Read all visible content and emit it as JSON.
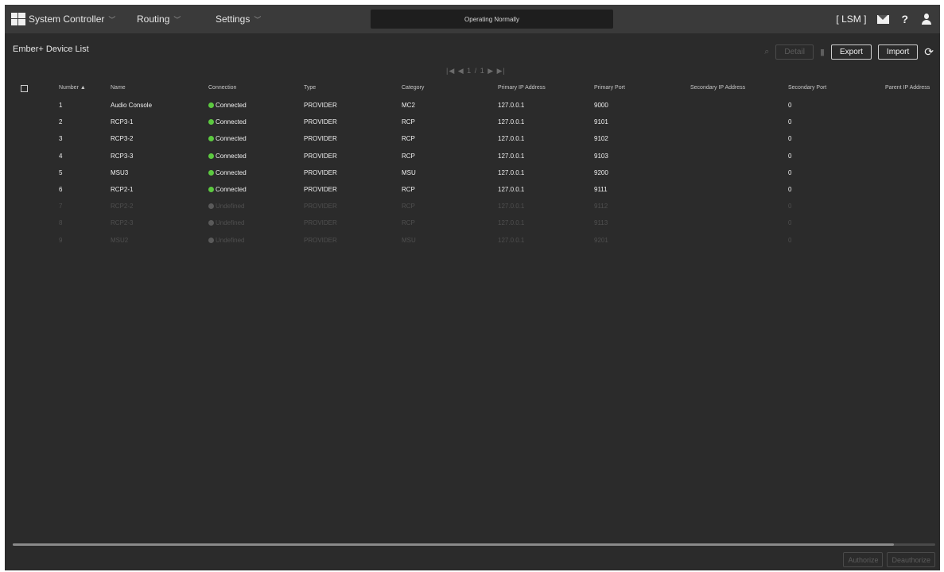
{
  "topbar": {
    "app_menu": "System Controller",
    "routing_menu": "Routing",
    "settings_menu": "Settings",
    "status": "Operating Normally",
    "mode": "[ LSM ]",
    "help": "?"
  },
  "page": {
    "title": "Ember+ Device List",
    "pager": "|◀ ◀ 1 / 1 ▶ ▶|"
  },
  "toolbar": {
    "detail_label": "Detail",
    "export_label": "Export",
    "import_label": "Import"
  },
  "table": {
    "headers": {
      "number": "Number ▲",
      "name": "Name",
      "connection": "Connection",
      "type": "Type",
      "category": "Category",
      "primary_ip": "Primary IP Address",
      "primary_port": "Primary Port",
      "secondary_ip": "Secondary IP Address",
      "secondary_port": "Secondary Port",
      "parent_ip": "Parent IP Address"
    },
    "rows": [
      {
        "number": "1",
        "name": "Audio Console",
        "connection": "Connected",
        "type": "PROVIDER",
        "category": "MC2",
        "primary_ip": "127.0.0.1",
        "primary_port": "9000",
        "secondary_ip": "",
        "secondary_port": "0",
        "parent_ip": ""
      },
      {
        "number": "2",
        "name": "RCP3-1",
        "connection": "Connected",
        "type": "PROVIDER",
        "category": "RCP",
        "primary_ip": "127.0.0.1",
        "primary_port": "9101",
        "secondary_ip": "",
        "secondary_port": "0",
        "parent_ip": ""
      },
      {
        "number": "3",
        "name": "RCP3-2",
        "connection": "Connected",
        "type": "PROVIDER",
        "category": "RCP",
        "primary_ip": "127.0.0.1",
        "primary_port": "9102",
        "secondary_ip": "",
        "secondary_port": "0",
        "parent_ip": ""
      },
      {
        "number": "4",
        "name": "RCP3-3",
        "connection": "Connected",
        "type": "PROVIDER",
        "category": "RCP",
        "primary_ip": "127.0.0.1",
        "primary_port": "9103",
        "secondary_ip": "",
        "secondary_port": "0",
        "parent_ip": ""
      },
      {
        "number": "5",
        "name": "MSU3",
        "connection": "Connected",
        "type": "PROVIDER",
        "category": "MSU",
        "primary_ip": "127.0.0.1",
        "primary_port": "9200",
        "secondary_ip": "",
        "secondary_port": "0",
        "parent_ip": ""
      },
      {
        "number": "6",
        "name": "RCP2-1",
        "connection": "Connected",
        "type": "PROVIDER",
        "category": "RCP",
        "primary_ip": "127.0.0.1",
        "primary_port": "9111",
        "secondary_ip": "",
        "secondary_port": "0",
        "parent_ip": ""
      },
      {
        "number": "7",
        "name": "RCP2-2",
        "connection": "Undefined",
        "type": "PROVIDER",
        "category": "RCP",
        "primary_ip": "127.0.0.1",
        "primary_port": "9112",
        "secondary_ip": "",
        "secondary_port": "0",
        "parent_ip": ""
      },
      {
        "number": "8",
        "name": "RCP2-3",
        "connection": "Undefined",
        "type": "PROVIDER",
        "category": "RCP",
        "primary_ip": "127.0.0.1",
        "primary_port": "9113",
        "secondary_ip": "",
        "secondary_port": "0",
        "parent_ip": ""
      },
      {
        "number": "9",
        "name": "MSU2",
        "connection": "Undefined",
        "type": "PROVIDER",
        "category": "MSU",
        "primary_ip": "127.0.0.1",
        "primary_port": "9201",
        "secondary_ip": "",
        "secondary_port": "0",
        "parent_ip": ""
      }
    ]
  },
  "footer": {
    "authorize_label": "Authorize",
    "deauthorize_label": "Deauthorize"
  },
  "colors": {
    "connected": "#5cc940",
    "undefined": "#5a5a5a",
    "background": "#2b2b2b"
  },
  "icons": [
    "system-controller-logo-icon",
    "mail-icon",
    "help-icon",
    "user-icon",
    "search-icon",
    "trash-icon",
    "refresh-icon"
  ]
}
